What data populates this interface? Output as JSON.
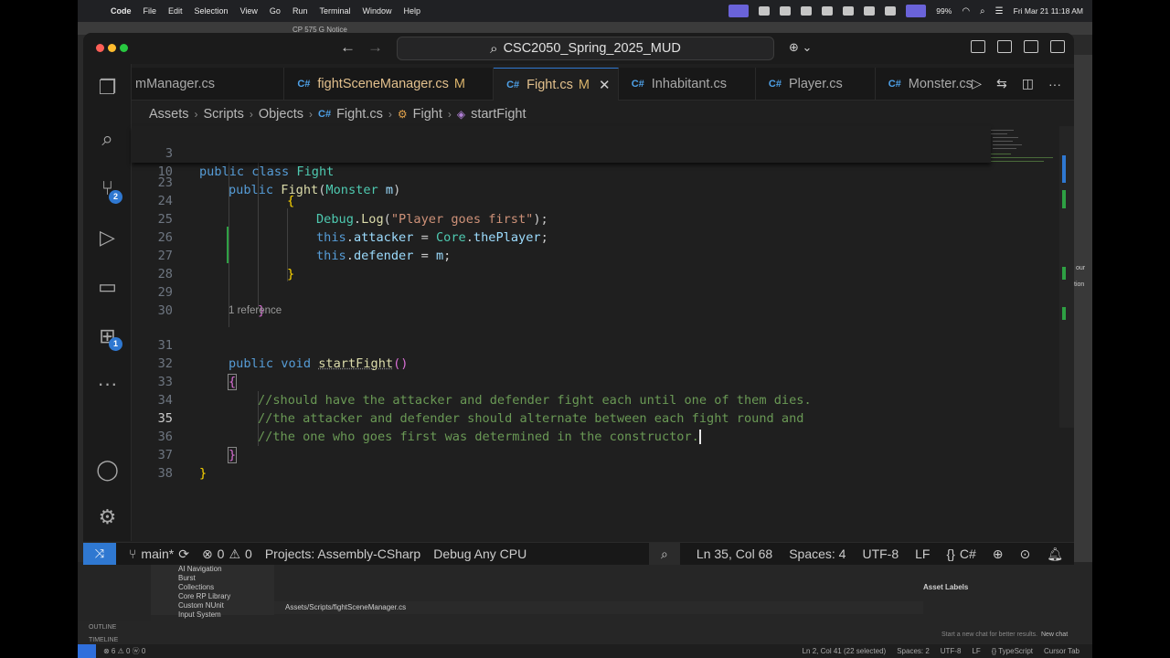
{
  "menubar": {
    "app": "Code",
    "items": [
      "File",
      "Edit",
      "Selection",
      "View",
      "Go",
      "Run",
      "Terminal",
      "Window",
      "Help"
    ],
    "battery": "99%",
    "datetime": "Fri Mar 21  11:18 AM"
  },
  "background": {
    "notice": "CP 575 G Notice",
    "project_items": [
      "AI Navigation",
      "Burst",
      "Collections",
      "Core RP Library",
      "Custom NUnit",
      "Input System"
    ],
    "path": "Assets/Scripts/fightSceneManager.cs",
    "asset_labels": "Asset Labels",
    "outline": "OUTLINE",
    "timeline": "TIMELINE",
    "chat_hint": "Start a new chat for better results.",
    "new_chat": "New chat",
    "status_left": "⊗ 6 ⚠ 0   ⓦ 0",
    "status_right": [
      "Ln 2, Col 41 (22 selected)",
      "Spaces: 2",
      "UTF-8",
      "LF",
      "{} TypeScript",
      "Cursor Tab"
    ],
    "side_text_1": "our",
    "side_text_2": "tion"
  },
  "titlebar": {
    "search": "CSC2050_Spring_2025_MUD"
  },
  "activity": {
    "scm_badge": "2",
    "extensions_badge": "1"
  },
  "tabs": [
    {
      "label": "mManager.cs",
      "modified": ""
    },
    {
      "label": "fightSceneManager.cs",
      "modified": "M"
    },
    {
      "label": "Fight.cs",
      "modified": "M"
    },
    {
      "label": "Inhabitant.cs",
      "modified": ""
    },
    {
      "label": "Player.cs",
      "modified": ""
    },
    {
      "label": "Monster.cs",
      "modified": ""
    }
  ],
  "breadcrumb": [
    "Assets",
    "Scripts",
    "Objects",
    "Fight.cs",
    "Fight",
    "startFight"
  ],
  "editor": {
    "sticky": [
      {
        "num": "3",
        "text": "public class Fight"
      },
      {
        "num": "10",
        "text": "public Fight(Monster m)"
      }
    ],
    "line_numbers": [
      "23",
      "24",
      "25",
      "26",
      "27",
      "28",
      "29",
      "30",
      "31",
      "32",
      "33",
      "34",
      "35",
      "36",
      "37",
      "38"
    ],
    "codelens": "1 reference",
    "log_str": "\"Player goes first\"",
    "comment1": "//should have the attacker and defender fight each until one of them dies.",
    "comment2": "//the attacker and defender should alternate between each fight round and",
    "comment3": "//the one who goes first was determined in the constructor."
  },
  "statusbar": {
    "branch": "main*",
    "errors": "0",
    "warnings": "0",
    "projects": "Projects: Assembly-CSharp",
    "config": "Debug Any CPU",
    "position": "Ln 35, Col 68",
    "spaces": "Spaces: 4",
    "encoding": "UTF-8",
    "eol": "LF",
    "language": "C#"
  }
}
